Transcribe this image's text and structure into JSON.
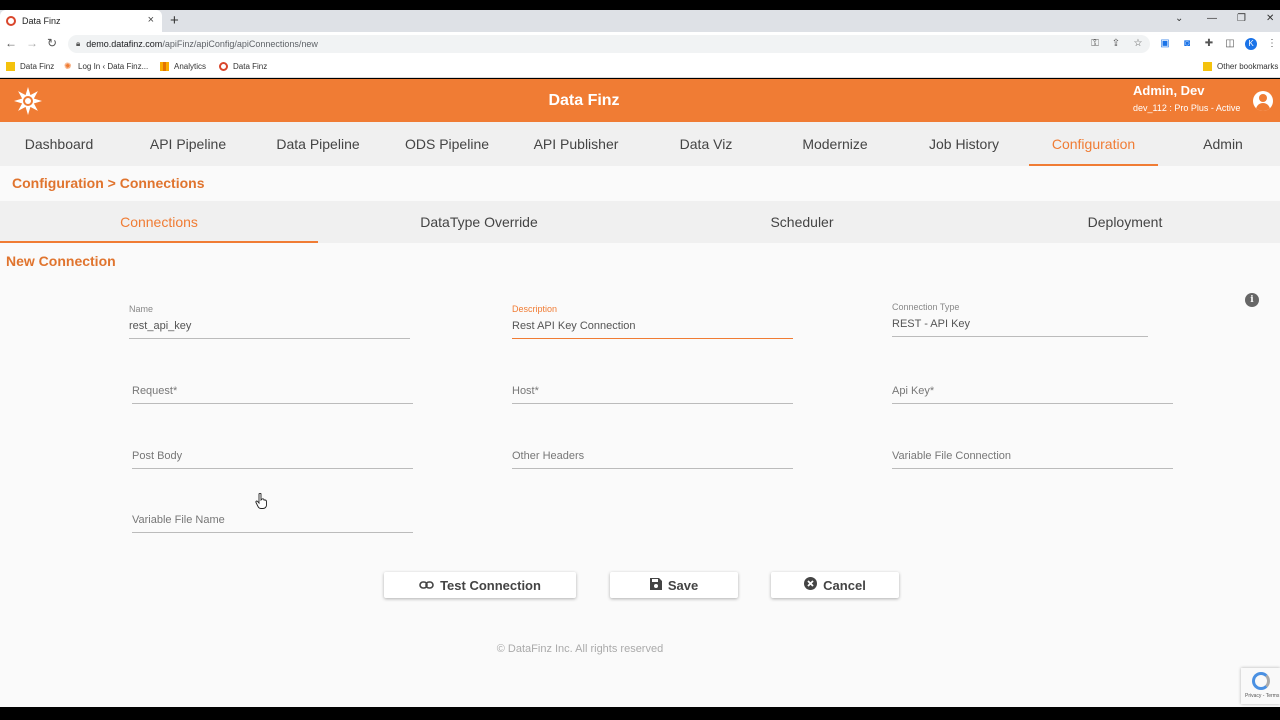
{
  "browser": {
    "tab_title": "Data Finz",
    "tab_close": "×",
    "new_tab": "+",
    "url_host": "demo.datafinz.com",
    "url_path": "/apiFinz/apiConfig/apiConnections/new",
    "bookmarks": [
      "Data Finz",
      "Log In ‹ Data Finz...",
      "Analytics",
      "Data Finz"
    ],
    "other_bookmarks": "Other bookmarks",
    "profile_initial": "K"
  },
  "app": {
    "title": "Data Finz",
    "user_name": "Admin, Dev",
    "user_sub": "dev_112 : Pro Plus - Active",
    "accent_color": "#f07c34"
  },
  "nav": {
    "items": [
      "Dashboard",
      "API Pipeline",
      "Data Pipeline",
      "ODS Pipeline",
      "API Publisher",
      "Data Viz",
      "Modernize",
      "Job History",
      "Configuration",
      "Admin"
    ],
    "active": "Configuration"
  },
  "breadcrumb": "Configuration > Connections",
  "subtabs": {
    "items": [
      "Connections",
      "DataType Override",
      "Scheduler",
      "Deployment"
    ],
    "active": "Connections"
  },
  "section_title": "New Connection",
  "form": {
    "name": {
      "label": "Name",
      "value": "rest_api_key"
    },
    "description": {
      "label": "Description",
      "value": "Rest API Key Connection"
    },
    "connection_type": {
      "label": "Connection Type",
      "value": "REST - API Key"
    },
    "request": {
      "placeholder": "Request*"
    },
    "host": {
      "placeholder": "Host*"
    },
    "api_key": {
      "placeholder": "Api Key*"
    },
    "post_body": {
      "placeholder": "Post Body"
    },
    "other_headers": {
      "placeholder": "Other Headers"
    },
    "variable_file_connection": {
      "placeholder": "Variable File Connection"
    },
    "variable_file_name": {
      "placeholder": "Variable File Name"
    }
  },
  "buttons": {
    "test_connection": "Test Connection",
    "save": "Save",
    "cancel": "Cancel"
  },
  "footer": "© DataFinz Inc. All rights reserved",
  "recaptcha_text": "Privacy - Terms"
}
